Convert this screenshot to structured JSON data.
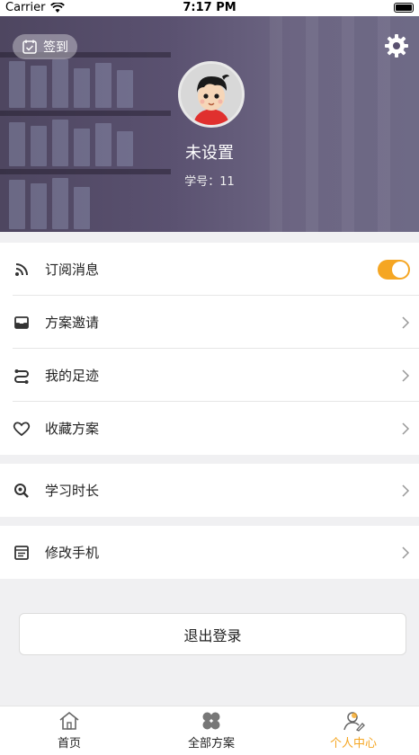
{
  "status_bar": {
    "carrier": "Carrier",
    "time": "7:17 PM"
  },
  "header": {
    "signin_label": "签到",
    "nickname": "未设置",
    "student_id": "学号：11"
  },
  "menu": {
    "group1": [
      {
        "label": "订阅消息",
        "icon": "rss-icon",
        "toggle_on": true
      },
      {
        "label": "方案邀请",
        "icon": "inbox-icon"
      },
      {
        "label": "我的足迹",
        "icon": "route-icon"
      },
      {
        "label": "收藏方案",
        "icon": "heart-icon"
      }
    ],
    "group2": [
      {
        "label": "学习时长",
        "icon": "magnify-icon"
      }
    ],
    "group3": [
      {
        "label": "修改手机",
        "icon": "phone-list-icon"
      }
    ]
  },
  "logout_label": "退出登录",
  "tabs": [
    {
      "label": "首页",
      "icon": "home-icon"
    },
    {
      "label": "全部方案",
      "icon": "clover-icon"
    },
    {
      "label": "个人中心",
      "icon": "user-icon"
    }
  ],
  "colors": {
    "accent": "#f5a623",
    "header_bg": "#5a5170"
  }
}
